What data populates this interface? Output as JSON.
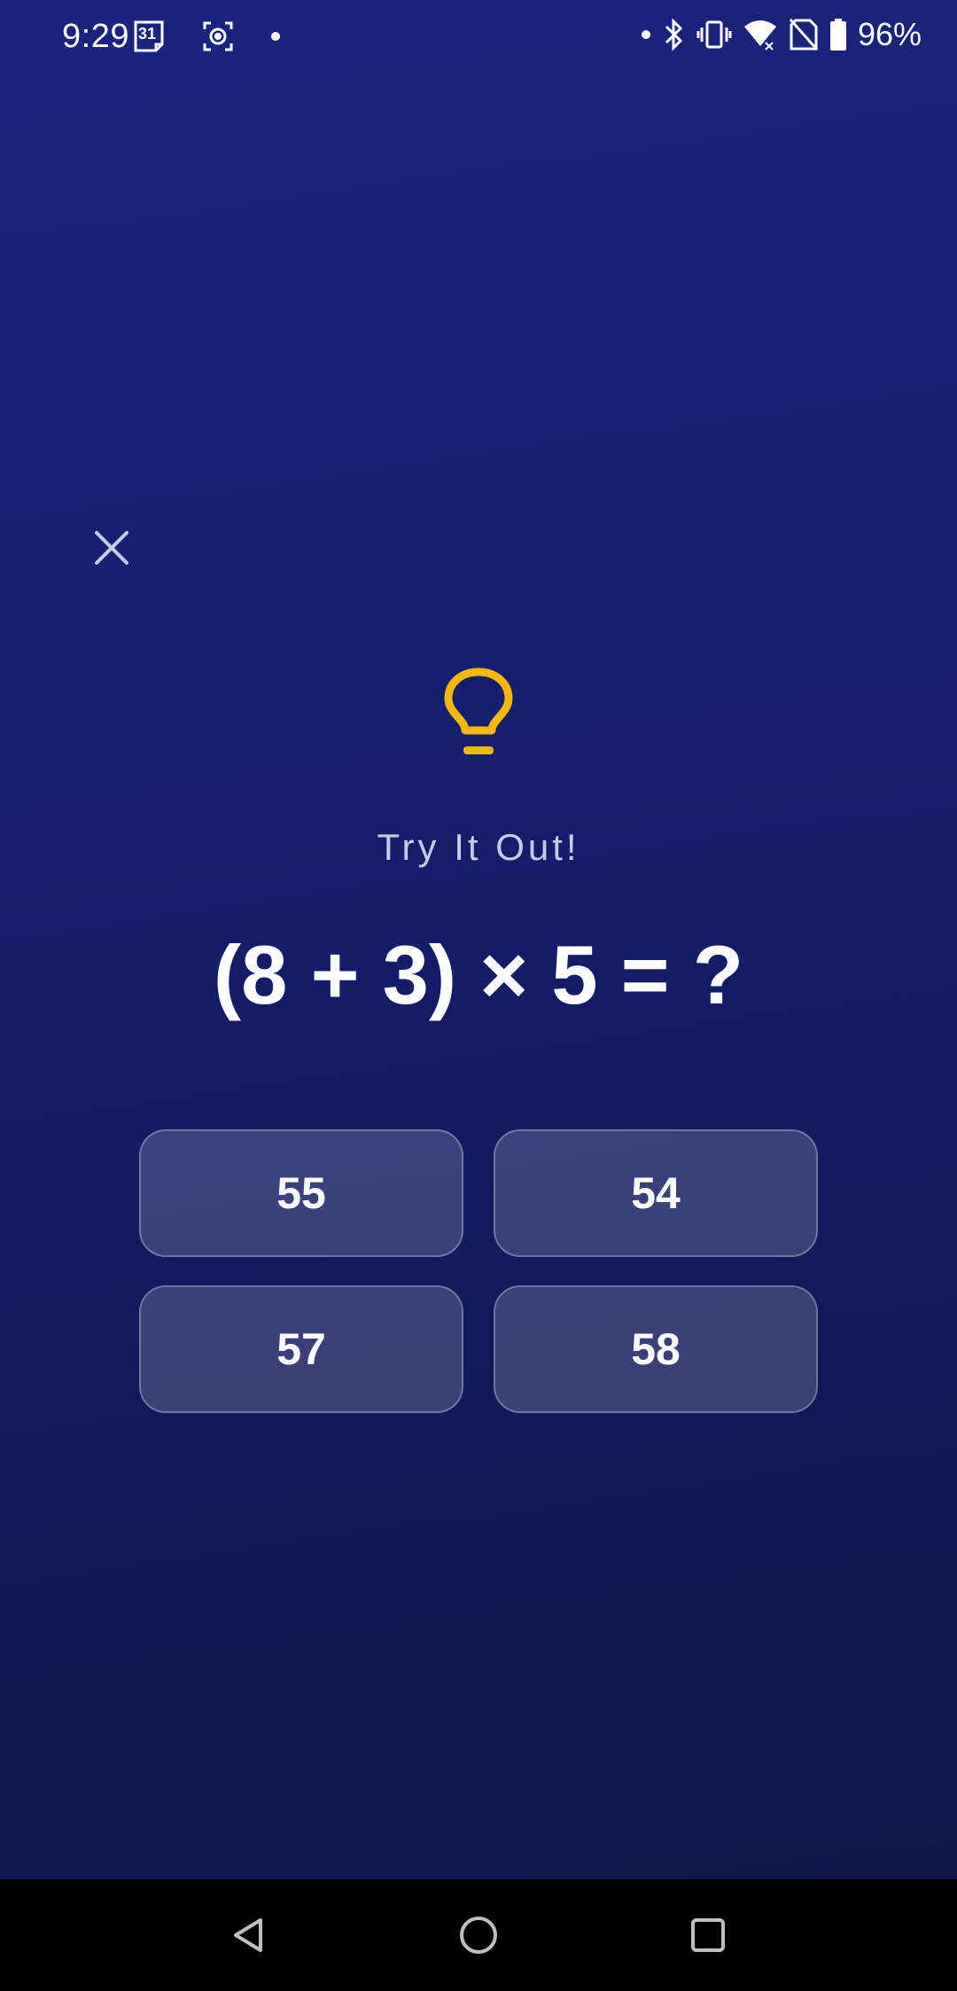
{
  "status_bar": {
    "time": "9:29",
    "calendar_day": "31",
    "battery": "96%"
  },
  "quiz": {
    "heading": "Try It Out!",
    "equation": "(8 + 3) × 5 = ?",
    "answers": [
      "55",
      "54",
      "57",
      "58"
    ]
  },
  "colors": {
    "accent_bulb": "#f5b800",
    "background_top": "#1b237f",
    "background_bottom": "#10164a"
  },
  "icons": {
    "close": "close-icon",
    "bulb": "lightbulb-icon",
    "nav_back": "back-triangle-icon",
    "nav_home": "home-circle-icon",
    "nav_recents": "recents-square-icon"
  }
}
